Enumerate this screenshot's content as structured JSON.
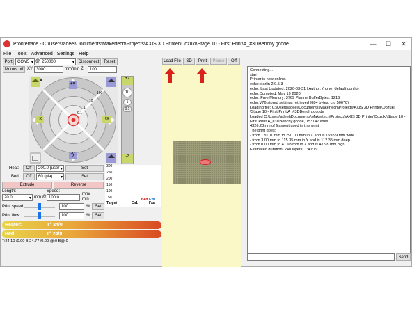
{
  "window": {
    "title": "Pronterface - C:\\Users\\adeel\\Documents\\Makertech\\Projects\\AXIS 3D Printer\\Dozuki\\Stage 10 - First Print\\A_#3DBenchy.gcode",
    "minimize": "—",
    "maximize": "☐",
    "close": "✕"
  },
  "menu": [
    "File",
    "Tools",
    "Advanced",
    "Settings",
    "Help"
  ],
  "connection": {
    "port_label": "Port",
    "port_value": "COM5",
    "at_label": "@",
    "baud_value": "250000",
    "disconnect": "Disconnect",
    "reset": "Reset"
  },
  "motors": {
    "motors_off": "Motors off",
    "xy_label": "XY:",
    "xy_value": "3000",
    "mm_min_z": "mm/min Z:",
    "z_value": "100"
  },
  "jog": {
    "x_minus": "-x",
    "x_plus": "+x",
    "y_plus": "+y",
    "y_minus": "-y",
    "ring_labels": [
      "100",
      "10",
      "1",
      "0.1"
    ],
    "z_labels": [
      "10",
      "1",
      "0.1"
    ],
    "z_plus": "+z",
    "z_minus": "-z"
  },
  "temps": {
    "heat_label": "Heat:",
    "heat_off": "Off",
    "heat_value": "200.0 (user",
    "heat_set": "Set",
    "bed_label": "Bed:",
    "bed_off": "Off",
    "bed_value": "60 (pla)",
    "bed_set": "Set",
    "graph_ticks": [
      "300",
      "250",
      "200",
      "150",
      "100",
      "50"
    ],
    "graph_legend": [
      "Bed",
      "Ex0",
      "Target",
      "Ex1",
      "Fan"
    ]
  },
  "extrude": {
    "extrude": "Extrude",
    "reverse": "Reverse",
    "length_label": "Length:",
    "length_value": "20.0",
    "mm_at": "mm @",
    "speed_label": "Speed:",
    "speed_value": "100.0",
    "speed_unit_1": "mm/",
    "speed_unit_2": "min"
  },
  "print_speed": {
    "label": "Print speed:",
    "value": "100",
    "percent": "%",
    "set": "Set",
    "level": 0.5
  },
  "print_flow": {
    "label": "Print flow:",
    "value": "100",
    "percent": "%",
    "set": "Set",
    "level": 0.5
  },
  "heater_bar": {
    "label": "Heater:",
    "temp": "T° 24/0"
  },
  "bed_bar": {
    "label": "Bed:",
    "temp": "T° 24/0"
  },
  "status_line": "T:24.10 /0.00 B:24.77 /0.00 @:0 B@:0",
  "toolbar": {
    "load_file": "Load File",
    "sd": "SD",
    "print": "Print",
    "pause": "Pause",
    "off": "Off"
  },
  "log": {
    "lines": [
      "Connecting...",
      "start",
      "Printer is now online.",
      "echo:Marlin 2.0.5.3",
      "echo: Last Updated: 2020-03-31 | Author: (none, default config)",
      "echo:Compiled: May 19 2020",
      "echo: Free Memory: 3769  PlannerBufferBytes: 1216",
      "echo:V76 stored settings retrieved (684 bytes; crc 50678)",
      "Loading file: C:\\Users\\adeel\\Documents\\Makertech\\Projects\\AXIS 3D Printer\\Dozuki",
      "\\Stage 10 - First Print\\A_#3DBenchy.gcode",
      "Loaded C:\\Users\\adeel\\Documents\\Makertech\\Projects\\AXIS 3D Printer\\Dozuki\\Stage 10 -",
      "First Print\\A_#3DBenchy.gcode, 153147 lines",
      "4326.23mm of filament used in this print",
      "The print goes:",
      "- from 120.01 mm to 290.00 mm in X and is 169.99 mm wide",
      "- from 3.00 mm to 115.35 mm in Y and is 112.35 mm deep",
      "- from 0.00 mm to 47.98 mm in Z and is 47.98 mm high",
      "Estimated duration: 240 layers, 1:41:19"
    ],
    "send": "Send"
  }
}
